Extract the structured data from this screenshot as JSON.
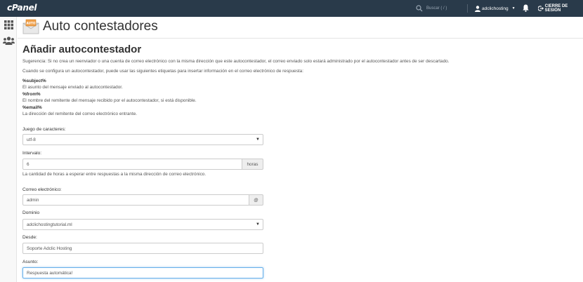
{
  "topbar": {
    "logo": "cPanel",
    "search_placeholder": "Buscar ( / )",
    "user": "adclichosting",
    "logout": "CIERRE DE SESIÓN"
  },
  "page": {
    "title": "Auto contestadores",
    "icon_label": "AUTO"
  },
  "form": {
    "section_title": "Añadir autocontestador",
    "hint1": "Sugerencia: Si no crea un reenviador o una cuenta de correo electrónico con la misma dirección que este autocontestador, el correo enviado solo estará administrado por el autocontestador antes de ser descartado.",
    "hint2": "Cuando se configura un autocontestador, puede usar las siguientes etiquetas para insertar información en el correo electrónico de respuesta:",
    "tags": [
      {
        "tag": "%subject%",
        "desc": "El asunto del mensaje enviado al autocontestador."
      },
      {
        "tag": "%from%",
        "desc": "El nombre del remitente del mensaje recibido por el autocontestador, si está disponible."
      },
      {
        "tag": "%email%",
        "desc": "La dirección del remitente del correo electrónico entrante."
      }
    ],
    "charset": {
      "label": "Juego de caracteres:",
      "value": "utf-8"
    },
    "interval": {
      "label": "Intervalo:",
      "value": "6",
      "addon": "horas",
      "help": "La cantidad de horas a esperar entre respuestas a la misma dirección de correo electrónico."
    },
    "email": {
      "label": "Correo electrónico:",
      "value": "admin",
      "addon": "@"
    },
    "domain": {
      "label": "Dominio",
      "value": "adclichostingtutorial.ml"
    },
    "from": {
      "label": "Desde:",
      "value": "Soporte Adclic Hosting"
    },
    "subject": {
      "label": "Asunto:",
      "value": "Respuesta automática!"
    }
  }
}
